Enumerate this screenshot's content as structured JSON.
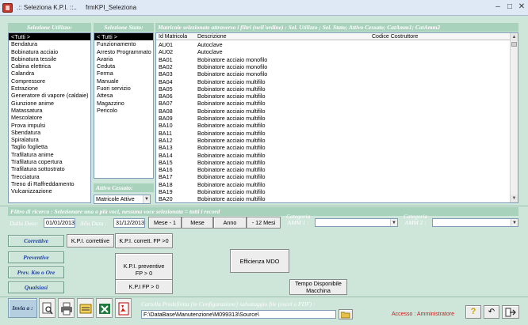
{
  "window": {
    "title": ".:: Seleziona K.P.I. ::..     frmKPI_Seleziona"
  },
  "utilizzo": {
    "header": "Selezione Utilizzo:",
    "items": [
      "<Tutti >",
      "Bendatura",
      "Bobinatura acciaio",
      "Bobinatura tessile",
      "Cabina elettrica",
      "Calandra",
      "Compressore",
      "Estrazione",
      "Generatore di vapore (caldaie)",
      "Giunzione anime",
      "Matassatura",
      "Mescolatore",
      "Prova impulsi",
      "Sbendatura",
      "Spiralatura",
      "Taglio foglietta",
      "Trafilatura anime",
      "Trafilatura copertura",
      "Trafilatura sottostrato",
      "Trecciatura",
      "Treno di Raffreddamento",
      "Vulcanizzazione"
    ]
  },
  "stato": {
    "header": "Selezione Stato:",
    "items": [
      "< Tutti >",
      "Funzionamento",
      "Arresto Programmato",
      "Avaria",
      "Ceduta",
      "Ferma",
      "Manuale",
      "Fuori servizio",
      "Attesa",
      "Magazzino",
      "Pericolo"
    ]
  },
  "attivo": {
    "header": "Attivo Cessato:",
    "value": "Matricole Attive"
  },
  "matricole": {
    "header": "Matricole selezionate attraverso i filtri (nell'ordine) :  Sel. Utilizzo ; Sel. Stato; Attivo Cessato; CatAmm1; CatAmm2",
    "columns": [
      "Id Matricola",
      "Descrizione",
      "Codice Costruttore"
    ],
    "rows": [
      [
        "AU01",
        "Autoclave",
        ""
      ],
      [
        "AU02",
        "Autoclave",
        ""
      ],
      [
        "BA01",
        "Bobinatore acciaio monofilo",
        ""
      ],
      [
        "BA02",
        "Bobinatore acciaio monofilo",
        ""
      ],
      [
        "BA03",
        "Bobinatore acciaio monofilo",
        ""
      ],
      [
        "BA04",
        "Bobinatore acciaio multifilo",
        ""
      ],
      [
        "BA05",
        "Bobinatore acciaio multifilo",
        ""
      ],
      [
        "BA06",
        "Bobinatore acciaio multifilo",
        ""
      ],
      [
        "BA07",
        "Bobinatore acciaio multifilo",
        ""
      ],
      [
        "BA08",
        "Bobinatore acciaio multifilo",
        ""
      ],
      [
        "BA09",
        "Bobinatore acciaio multifilo",
        ""
      ],
      [
        "BA10",
        "Bobinatore acciaio multifilo",
        ""
      ],
      [
        "BA11",
        "Bobinatore acciaio multifilo",
        ""
      ],
      [
        "BA12",
        "Bobinatore acciaio multifilo",
        ""
      ],
      [
        "BA13",
        "Bobinatore acciaio multifilo",
        ""
      ],
      [
        "BA14",
        "Bobinatore acciaio multifilo",
        ""
      ],
      [
        "BA15",
        "Bobinatore acciaio multifilo",
        ""
      ],
      [
        "BA16",
        "Bobinatore acciaio multifilo",
        ""
      ],
      [
        "BA17",
        "Bobinatore acciaio multifilo",
        ""
      ],
      [
        "BA18",
        "Bobinatore acciaio multifilo",
        ""
      ],
      [
        "BA19",
        "Bobinatore acciaio multifilo",
        ""
      ],
      [
        "BA20",
        "Bobinatore acciaio multifilo",
        ""
      ]
    ]
  },
  "filtro": {
    "header": "Filtro di ricerca :  Selezionare una o più voci, nessuna voce selezionata = tutti i record",
    "dalla_label": "Dalla Data:",
    "dalla_value": "01/01/2013",
    "alla_label": "Alla Data :",
    "alla_value": "31/12/2013",
    "buttons": [
      "Mese - 1",
      "Mese",
      "Anno",
      "- 12 Mesi"
    ],
    "cat1_label": "Categoria\nAMM 1 :",
    "cat2_label": "Categoria\nAMM 2 :"
  },
  "side_buttons": [
    "Correttive",
    "Preventive",
    "Prev.  Km o Ore",
    "Qualsiasi"
  ],
  "kpi_buttons": {
    "correttive": "K.P.I. correttive",
    "corrett_fp": "K.P.I. corrett. FP >0",
    "preventive": "K.P.I. preventive\nFP > 0",
    "kpi_fp": "K.P.I  FP > 0",
    "efficienza": "Efficienza MDO",
    "tempo": "Tempo Disponibile\nMacchina"
  },
  "bottom": {
    "invia_label": "Invia a :",
    "cartella_label": "Cartella Predefinita [in Configurazione] salvataggio file (excel o PDF) :",
    "path": "F:\\DataBase\\Manutenzione\\M099313\\Source\\",
    "accesso": "Accesso : Amministratore"
  },
  "colors": {
    "form_bg": "#cde6d9",
    "header_bg": "#a9d2bd",
    "side_text": "#1c3faa",
    "accesso": "#d01818"
  }
}
